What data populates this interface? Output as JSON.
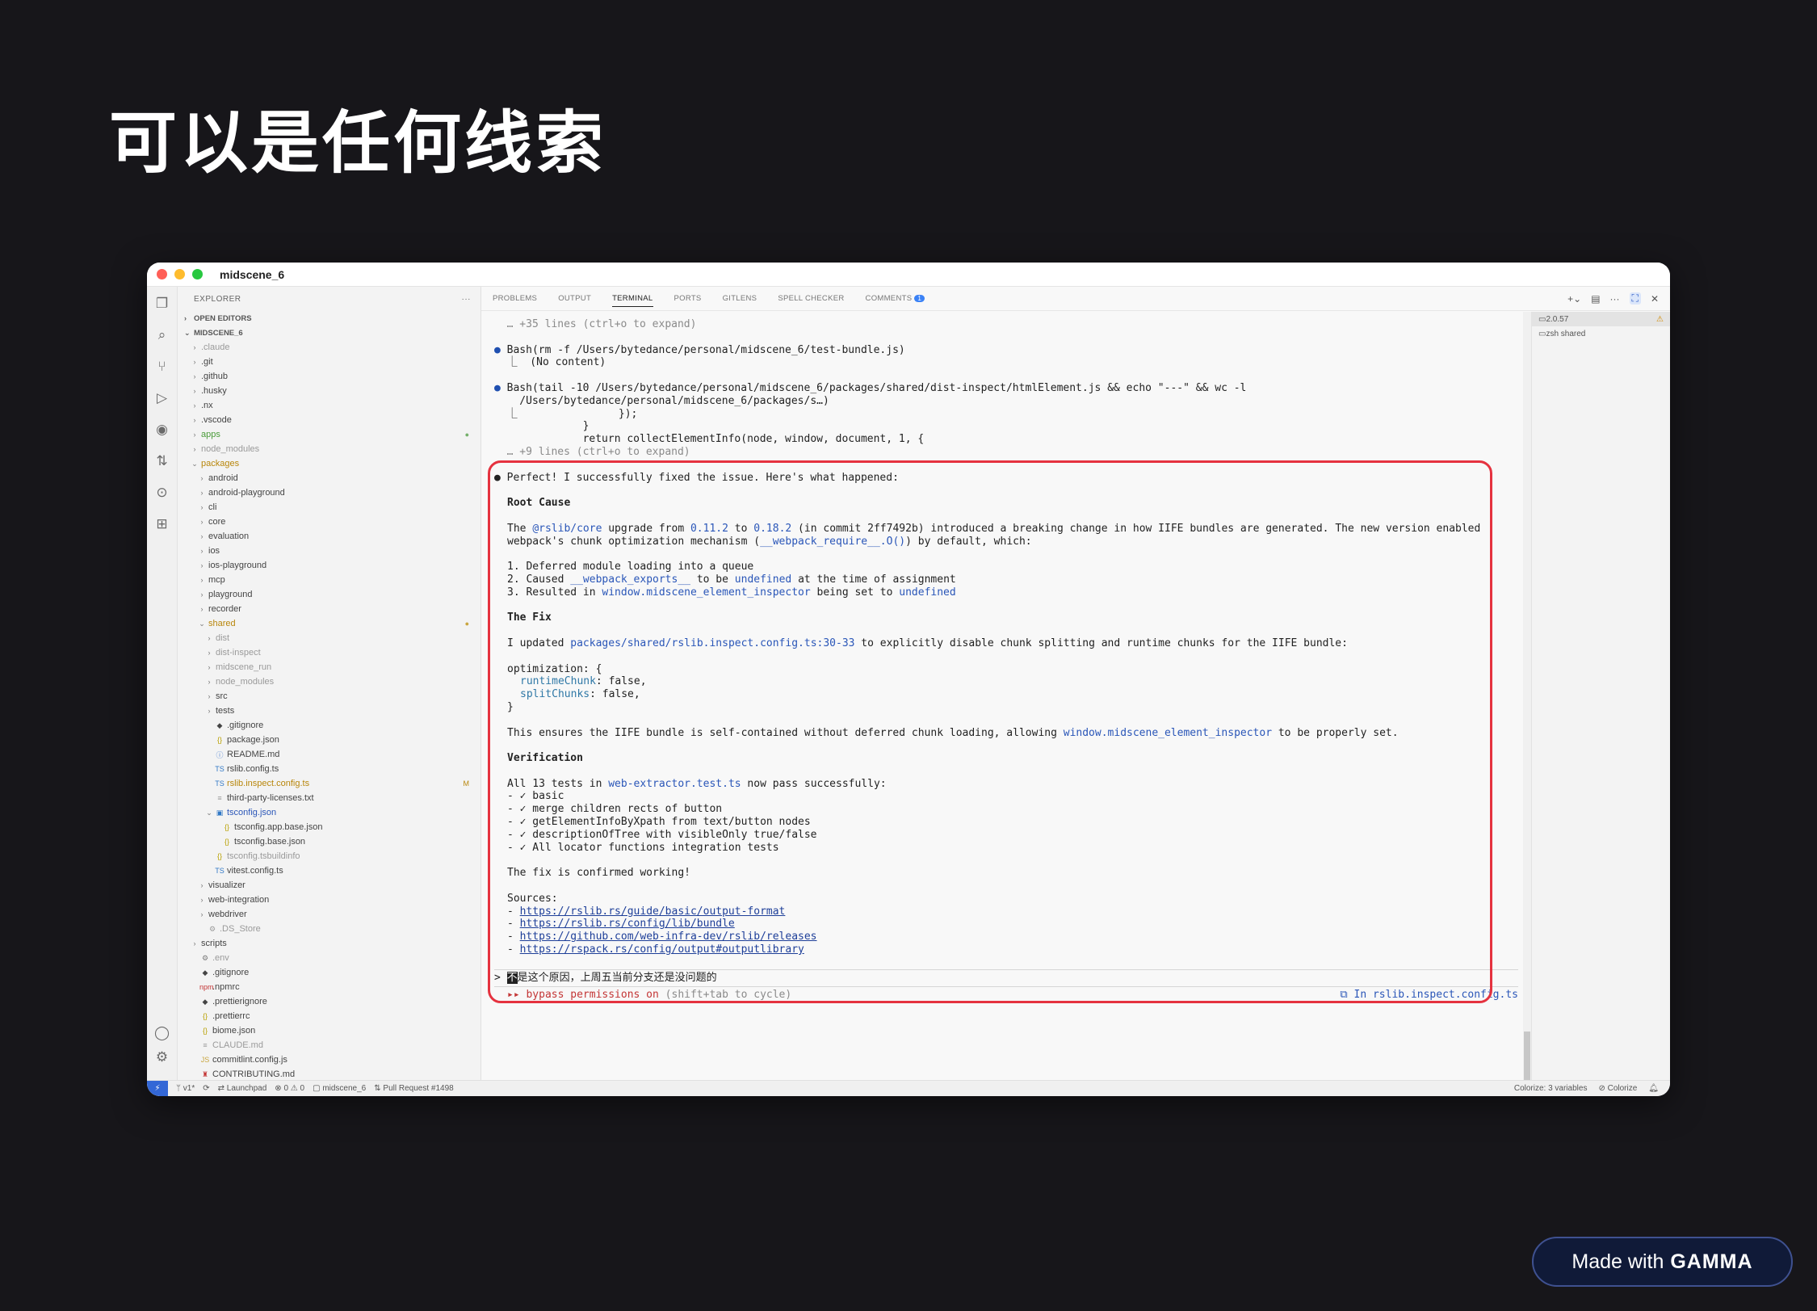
{
  "slide": {
    "title": "可以是任何线索"
  },
  "window": {
    "title": "midscene_6"
  },
  "sidebar": {
    "header": "EXPLORER",
    "more": "···",
    "open_editors": "OPEN EDITORS",
    "workspace": "MIDSCENE_6",
    "items": [
      {
        "label": ".claude",
        "depth": 1,
        "type": "folder",
        "color": "#9a9a9a"
      },
      {
        "label": ".git",
        "depth": 1,
        "type": "folder",
        "color": "#444444"
      },
      {
        "label": ".github",
        "depth": 1,
        "type": "folder",
        "color": "#444444"
      },
      {
        "label": ".husky",
        "depth": 1,
        "type": "folder",
        "color": "#444444"
      },
      {
        "label": ".nx",
        "depth": 1,
        "type": "folder",
        "color": "#444444"
      },
      {
        "label": ".vscode",
        "depth": 1,
        "type": "folder",
        "color": "#444444"
      },
      {
        "label": "apps",
        "depth": 1,
        "type": "folder",
        "color": "#4a9b3a",
        "deco": "●",
        "deco_color": "#74b06a"
      },
      {
        "label": "node_modules",
        "depth": 1,
        "type": "folder",
        "color": "#9a9a9a"
      },
      {
        "label": "packages",
        "depth": 1,
        "type": "folder-open",
        "color": "#b8860b"
      },
      {
        "label": "android",
        "depth": 2,
        "type": "folder",
        "color": "#444444"
      },
      {
        "label": "android-playground",
        "depth": 2,
        "type": "folder",
        "color": "#444444"
      },
      {
        "label": "cli",
        "depth": 2,
        "type": "folder",
        "color": "#444444"
      },
      {
        "label": "core",
        "depth": 2,
        "type": "folder",
        "color": "#444444"
      },
      {
        "label": "evaluation",
        "depth": 2,
        "type": "folder",
        "color": "#444444"
      },
      {
        "label": "ios",
        "depth": 2,
        "type": "folder",
        "color": "#444444"
      },
      {
        "label": "ios-playground",
        "depth": 2,
        "type": "folder",
        "color": "#444444"
      },
      {
        "label": "mcp",
        "depth": 2,
        "type": "folder",
        "color": "#444444"
      },
      {
        "label": "playground",
        "depth": 2,
        "type": "folder",
        "color": "#444444"
      },
      {
        "label": "recorder",
        "depth": 2,
        "type": "folder",
        "color": "#444444"
      },
      {
        "label": "shared",
        "depth": 2,
        "type": "folder-open",
        "color": "#b8860b",
        "deco": "●",
        "deco_color": "#c9a640"
      },
      {
        "label": "dist",
        "depth": 3,
        "type": "folder",
        "color": "#9a9a9a"
      },
      {
        "label": "dist-inspect",
        "depth": 3,
        "type": "folder",
        "color": "#9a9a9a"
      },
      {
        "label": "midscene_run",
        "depth": 3,
        "type": "folder",
        "color": "#9a9a9a"
      },
      {
        "label": "node_modules",
        "depth": 3,
        "type": "folder",
        "color": "#9a9a9a"
      },
      {
        "label": "src",
        "depth": 3,
        "type": "folder",
        "color": "#444444"
      },
      {
        "label": "tests",
        "depth": 3,
        "type": "folder",
        "color": "#444444"
      },
      {
        "label": ".gitignore",
        "depth": 3,
        "type": "file",
        "icon": "◆",
        "icon_color": "#444444",
        "color": "#444444"
      },
      {
        "label": "package.json",
        "depth": 3,
        "type": "file",
        "icon": "{}",
        "icon_color": "#b8a000",
        "color": "#444444"
      },
      {
        "label": "README.md",
        "depth": 3,
        "type": "file",
        "icon": "ⓘ",
        "icon_color": "#4a7fd0",
        "color": "#444444"
      },
      {
        "label": "rslib.config.ts",
        "depth": 3,
        "type": "file",
        "icon": "TS",
        "icon_color": "#3178c6",
        "color": "#444444"
      },
      {
        "label": "rslib.inspect.config.ts",
        "depth": 3,
        "type": "file",
        "icon": "TS",
        "icon_color": "#3178c6",
        "color": "#b8860b",
        "deco": "M",
        "deco_color": "#b8860b"
      },
      {
        "label": "third-party-licenses.txt",
        "depth": 3,
        "type": "file",
        "icon": "≡",
        "icon_color": "#999999",
        "color": "#444444"
      },
      {
        "label": "tsconfig.json",
        "depth": 3,
        "type": "file-open",
        "icon": "▣",
        "icon_color": "#3178c6",
        "color": "#2a56b8"
      },
      {
        "label": "tsconfig.app.base.json",
        "depth": 4,
        "type": "file",
        "icon": "{}",
        "icon_color": "#b8a000",
        "color": "#444444"
      },
      {
        "label": "tsconfig.base.json",
        "depth": 4,
        "type": "file",
        "icon": "{}",
        "icon_color": "#b8a000",
        "color": "#444444"
      },
      {
        "label": "tsconfig.tsbuildinfo",
        "depth": 3,
        "type": "file",
        "icon": "{}",
        "icon_color": "#b8a000",
        "color": "#9a9a9a"
      },
      {
        "label": "vitest.config.ts",
        "depth": 3,
        "type": "file",
        "icon": "TS",
        "icon_color": "#3178c6",
        "color": "#444444"
      },
      {
        "label": "visualizer",
        "depth": 2,
        "type": "folder",
        "color": "#444444"
      },
      {
        "label": "web-integration",
        "depth": 2,
        "type": "folder",
        "color": "#444444"
      },
      {
        "label": "webdriver",
        "depth": 2,
        "type": "folder",
        "color": "#444444"
      },
      {
        "label": ".DS_Store",
        "depth": 2,
        "type": "file",
        "icon": "⚙",
        "icon_color": "#999999",
        "color": "#9a9a9a"
      },
      {
        "label": "scripts",
        "depth": 1,
        "type": "folder",
        "color": "#444444"
      },
      {
        "label": ".env",
        "depth": 1,
        "type": "file",
        "icon": "⚙",
        "icon_color": "#777777",
        "color": "#9a9a9a"
      },
      {
        "label": ".gitignore",
        "depth": 1,
        "type": "file",
        "icon": "◆",
        "icon_color": "#444444",
        "color": "#444444"
      },
      {
        "label": ".npmrc",
        "depth": 1,
        "type": "file",
        "icon": "npm",
        "icon_color": "#c33535",
        "color": "#444444"
      },
      {
        "label": ".prettierignore",
        "depth": 1,
        "type": "file",
        "icon": "◆",
        "icon_color": "#444444",
        "color": "#444444"
      },
      {
        "label": ".prettierrc",
        "depth": 1,
        "type": "file",
        "icon": "{}",
        "icon_color": "#b8a000",
        "color": "#444444"
      },
      {
        "label": "biome.json",
        "depth": 1,
        "type": "file",
        "icon": "{}",
        "icon_color": "#b8a000",
        "color": "#444444"
      },
      {
        "label": "CLAUDE.md",
        "depth": 1,
        "type": "file",
        "icon": "≡",
        "icon_color": "#999999",
        "color": "#9a9a9a"
      },
      {
        "label": "commitlint.config.js",
        "depth": 1,
        "type": "file",
        "icon": "JS",
        "icon_color": "#c9a640",
        "color": "#444444"
      },
      {
        "label": "CONTRIBUTING.md",
        "depth": 1,
        "type": "file",
        "icon": "♜",
        "icon_color": "#c33535",
        "color": "#444444"
      }
    ]
  },
  "panel": {
    "tabs": [
      {
        "label": "PROBLEMS",
        "active": false
      },
      {
        "label": "OUTPUT",
        "active": false
      },
      {
        "label": "TERMINAL",
        "active": true
      },
      {
        "label": "PORTS",
        "active": false
      },
      {
        "label": "GITLENS",
        "active": false
      },
      {
        "label": "SPELL CHECKER",
        "active": false
      },
      {
        "label": "COMMENTS",
        "active": false,
        "badge": "1"
      }
    ],
    "tools": [
      "+⌄",
      "▤",
      "···",
      "⛶",
      "✕"
    ]
  },
  "terminal_split": [
    {
      "label": "2.0.57",
      "selected": true,
      "warn": "⚠"
    },
    {
      "label": "zsh  shared",
      "selected": false
    }
  ],
  "terminal": {
    "l1": "  … +35 lines (ctrl+o to expand)",
    "bash1_cmd": "Bash(rm -f /Users/bytedance/personal/midscene_6/test-bundle.js)",
    "bash1_out": "  ⎿  (No content)",
    "bash2_cmd": "Bash(tail -10 /Users/bytedance/personal/midscene_6/packages/shared/dist-inspect/htmlElement.js && echo \"---\" && wc -l",
    "bash2_cont": "    /Users/bytedance/personal/midscene_6/packages/s…)",
    "bash2_o1": "  ⎿                });",
    "bash2_o2": "              }",
    "bash2_o3": "              return collectElementInfo(node, window, document, 1, {",
    "bash2_o4": "  … +9 lines (ctrl+o to expand)",
    "perfect": "Perfect! I successfully fixed the issue. Here's what happened:",
    "root_cause": "Root Cause",
    "rc_a": "The ",
    "rc_pkg": "@rslib/core",
    "rc_b": " upgrade from ",
    "rc_v1": "0.11.2",
    "rc_c": " to ",
    "rc_v2": "0.18.2",
    "rc_d": " (in commit 2ff7492b) introduced a breaking change in how IIFE bundles are generated. The new version enabled",
    "rc2_a": "webpack's chunk optimization mechanism (",
    "rc2_fn": "__webpack_require__.O()",
    "rc2_b": ") by default, which:",
    "item1": "1. Deferred module loading into a queue",
    "item2_a": "2. Caused ",
    "item2_code": "__webpack_exports__",
    "item2_b": " to be ",
    "item2_undef": "undefined",
    "item2_c": " at the time of assignment",
    "item3_a": "3. Resulted in ",
    "item3_code": "window.midscene_element_inspector",
    "item3_b": " being set to ",
    "item3_undef": "undefined",
    "the_fix": "The Fix",
    "fix_a": "I updated ",
    "fix_path": "packages/shared/rslib.inspect.config.ts:30-33",
    "fix_b": " to explicitly disable chunk splitting and runtime chunks for the IIFE bundle:",
    "code1": "optimization: {",
    "code2_key": "runtimeChunk",
    "code2_val": ": false,",
    "code3_key": "splitChunks",
    "code3_val": ": false,",
    "code4": "}",
    "ensures_a": "This ensures the IIFE bundle is self-contained without deferred chunk loading, allowing ",
    "ensures_code": "window.midscene_element_inspector",
    "ensures_b": " to be properly set.",
    "verification": "Verification",
    "ver_a": "All 13 tests in ",
    "ver_file": "web-extractor.test.ts",
    "ver_b": " now pass successfully:",
    "t1": "- ✓ basic",
    "t2": "- ✓ merge children rects of button",
    "t3": "- ✓ getElementInfoByXpath from text/button nodes",
    "t4": "- ✓ descriptionOfTree with visibleOnly true/false",
    "t5": "- ✓ All locator functions integration tests",
    "confirmed": "The fix is confirmed working!",
    "sources": "Sources:",
    "src1": "https://rslib.rs/guide/basic/output-format",
    "src2": "https://rslib.rs/config/lib/bundle",
    "src3": "https://github.com/web-infra-dev/rslib/releases",
    "src4": "https://rspack.rs/config/output#outputlibrary",
    "prompt_caret": "> ",
    "prompt_first": "不",
    "prompt_rest": "是这个原因，上周五当前分支还是没问题的",
    "bypass": "▸▸ bypass permissions on",
    "bypass_hint": " (shift+tab to cycle)",
    "in_file": "⧉ In rslib.inspect.config.ts"
  },
  "statusbar": {
    "remote": "⚡",
    "branch": "ᛘ v1*",
    "sync": "⟳",
    "launchpad": "⇄ Launchpad",
    "problems": "⊗ 0 ⚠ 0",
    "folder": "▢ midscene_6",
    "pr": "⇅ Pull Request #1498",
    "colorize_vars": "Colorize: 3 variables",
    "colorize": "⊘ Colorize",
    "bell": "🔔︎"
  },
  "badge": {
    "prefix": "Made with",
    "brand": "GAMMA"
  },
  "colors": {
    "accent": "#3367d6",
    "highlight": "#e5323f",
    "background": "#17161a"
  }
}
